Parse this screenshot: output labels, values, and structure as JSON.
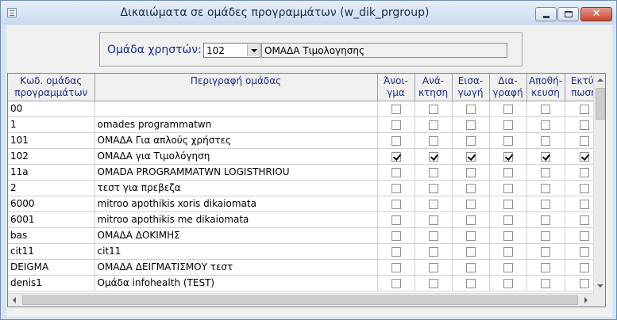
{
  "window": {
    "title": "Δικαιώματα σε ομάδες προγραμμάτων    (w_dik_prgroup)",
    "close_glyph": "✕"
  },
  "filter": {
    "label": "Ομάδα χρηστών:",
    "group_code": "102",
    "group_description": "ΟΜΑΔΑ Τιμολογησης"
  },
  "grid": {
    "columns": [
      "Κωδ. ομάδας προγραμμάτων",
      "Περιγραφή ομάδας",
      "Άνοι-γμα",
      "Ανά-κτηση",
      "Εισα-γωγή",
      "Δια-γραφή",
      "Αποθή-κευση",
      "Εκτύ-πωση"
    ],
    "rows": [
      {
        "code": "00",
        "description": "",
        "perms": [
          false,
          false,
          false,
          false,
          false,
          false
        ]
      },
      {
        "code": "1",
        "description": "omades programmatwn",
        "perms": [
          false,
          false,
          false,
          false,
          false,
          false
        ]
      },
      {
        "code": "101",
        "description": "ΟΜΑΔΑ Για απλούς χρήστες",
        "perms": [
          false,
          false,
          false,
          false,
          false,
          false
        ]
      },
      {
        "code": "102",
        "description": "ΟΜΑΔΑ για Τιμολόγηση",
        "perms": [
          true,
          true,
          true,
          true,
          true,
          true
        ]
      },
      {
        "code": "11a",
        "description": "OMADA PROGRAMMATWN LOGISTHRIOU",
        "perms": [
          false,
          false,
          false,
          false,
          false,
          false
        ]
      },
      {
        "code": "2",
        "description": "τεστ για πρεβεζα",
        "perms": [
          false,
          false,
          false,
          false,
          false,
          false
        ]
      },
      {
        "code": "6000",
        "description": "mitroo apothikis xoris dikaiomata",
        "perms": [
          false,
          false,
          false,
          false,
          false,
          false
        ]
      },
      {
        "code": "6001",
        "description": "mitroo apothikis me dikaiomata",
        "perms": [
          false,
          false,
          false,
          false,
          false,
          false
        ]
      },
      {
        "code": "bas",
        "description": "ΟΜΑΔΑ ΔΟΚΙΜΗΣ",
        "perms": [
          false,
          false,
          false,
          false,
          false,
          false
        ]
      },
      {
        "code": "cit11",
        "description": "cit11",
        "perms": [
          false,
          false,
          false,
          false,
          false,
          false
        ]
      },
      {
        "code": "DEIGMA",
        "description": "ΟΜΑΔΑ ΔΕΙΓΜΑΤΙΣΜΟΥ τεστ",
        "perms": [
          false,
          false,
          false,
          false,
          false,
          false
        ]
      },
      {
        "code": "denis1",
        "description": "Ομάδα infohealth (TEST)",
        "perms": [
          false,
          false,
          false,
          false,
          false,
          false
        ]
      }
    ]
  }
}
